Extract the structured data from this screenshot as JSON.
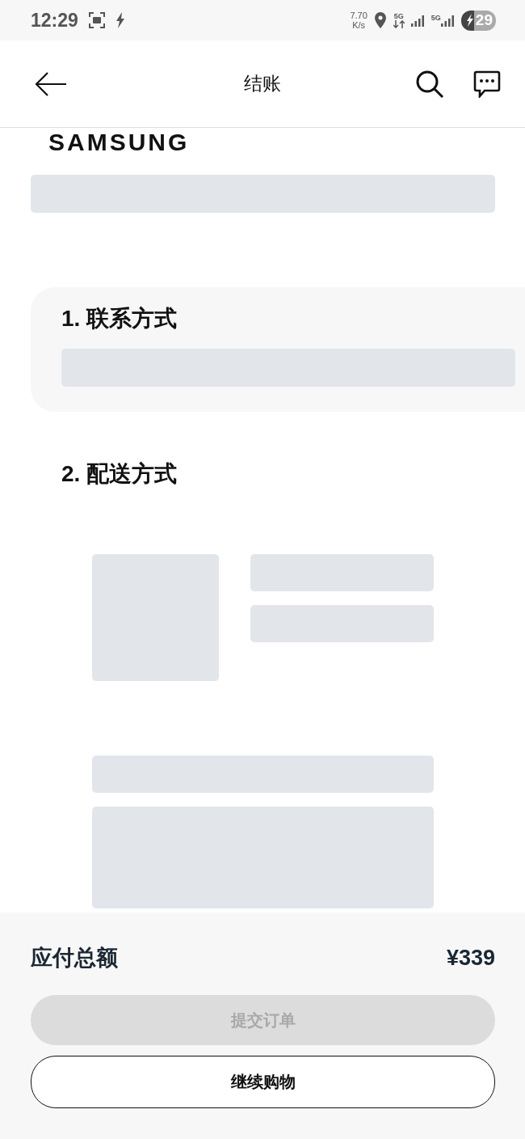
{
  "status_bar": {
    "time": "12:29",
    "net_speed": "7.70",
    "net_unit": "K/s",
    "network_1": "5G",
    "network_2": "5G",
    "battery": "29"
  },
  "header": {
    "title": "结账"
  },
  "brand": {
    "logo": "SAMSUNG"
  },
  "sections": [
    {
      "title": "1. 联系方式",
      "carded": true
    },
    {
      "title": "2. 配送方式",
      "carded": false
    }
  ],
  "summary": {
    "label": "应付总额",
    "amount": "¥339"
  },
  "buttons": [
    {
      "label": "提交订单",
      "kind": "primary",
      "disabled": true
    },
    {
      "label": "继续购物",
      "kind": "outline",
      "disabled": false
    }
  ]
}
